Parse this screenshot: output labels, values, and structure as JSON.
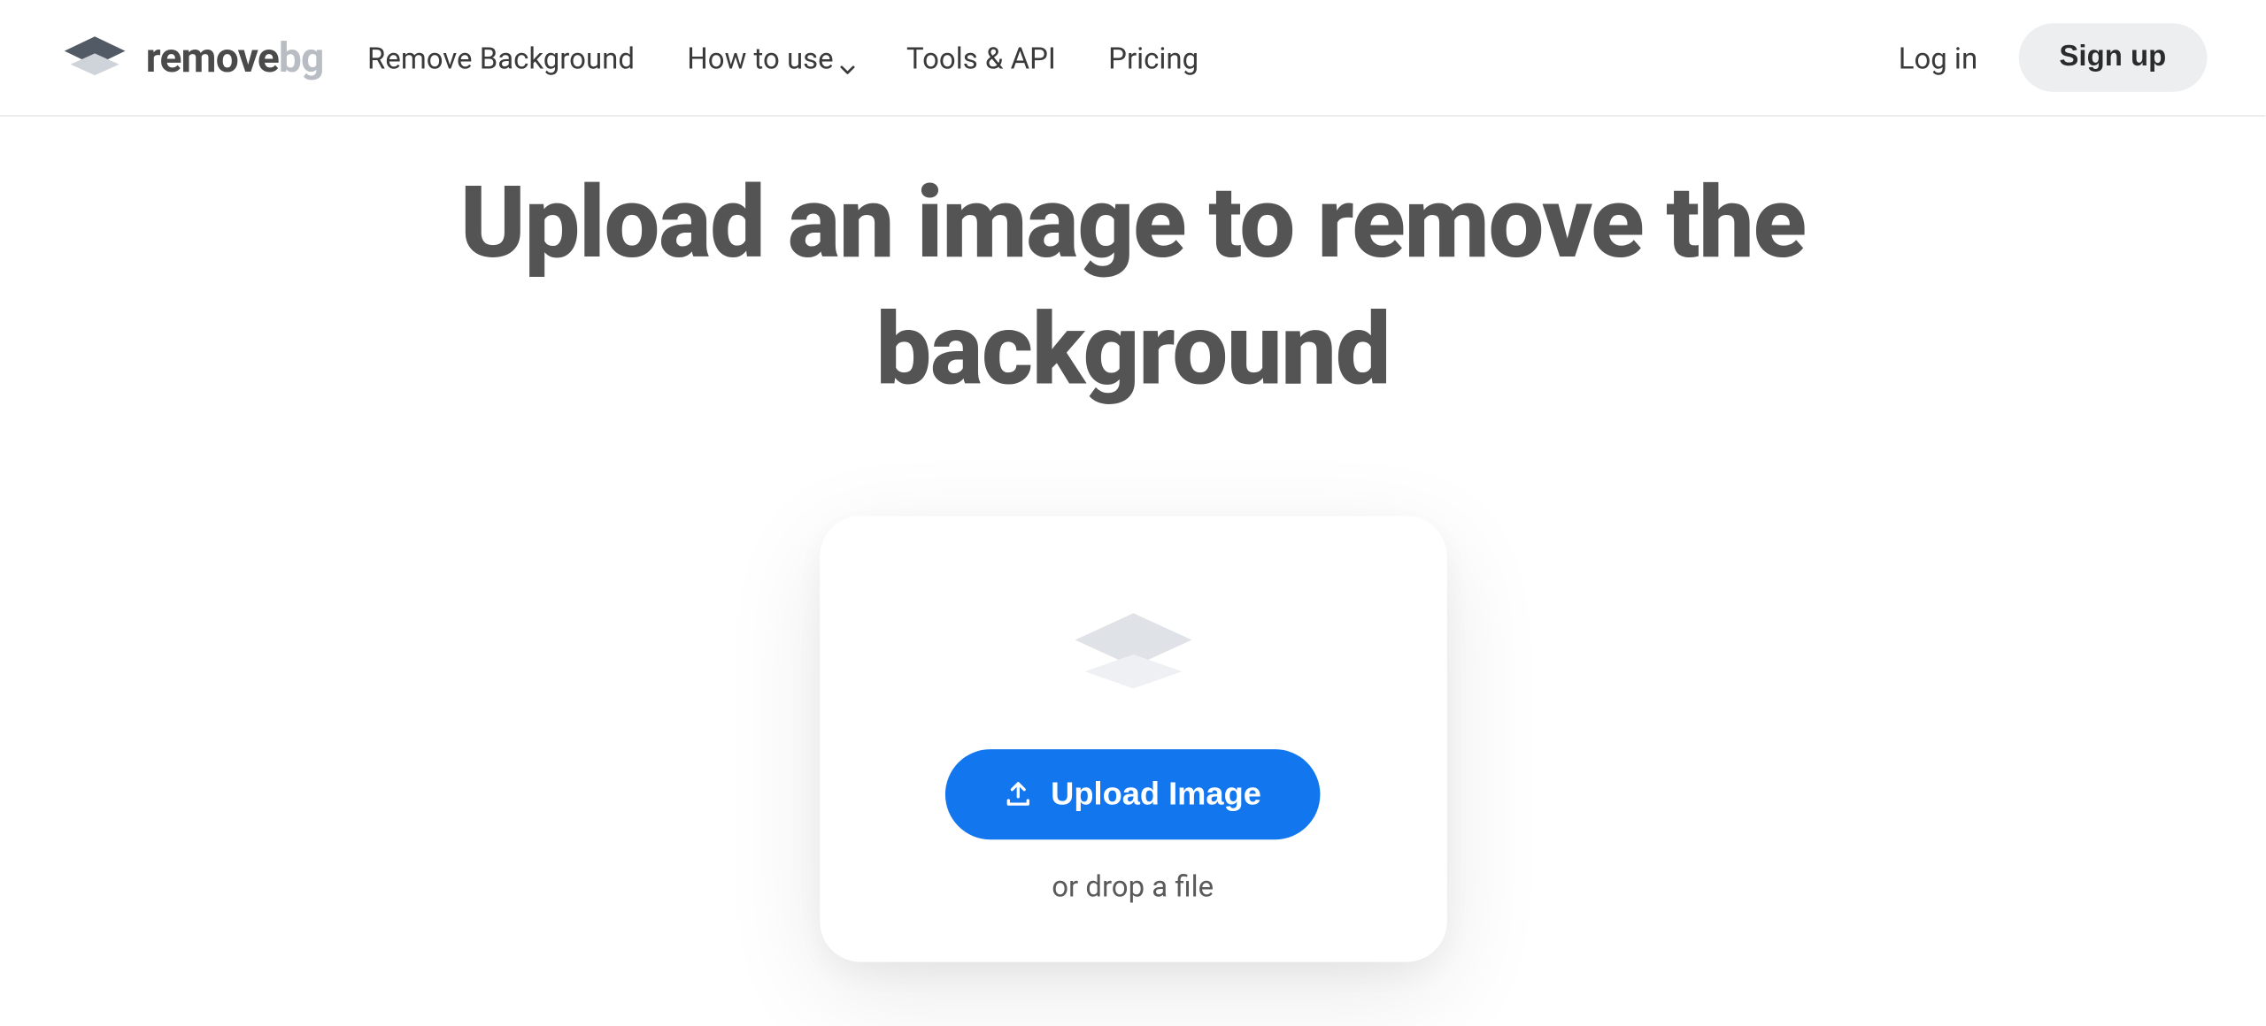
{
  "logo": {
    "text_remove": "remove",
    "text_bg": "bg"
  },
  "nav": {
    "items": [
      {
        "label": "Remove Background",
        "has_dropdown": false
      },
      {
        "label": "How to use",
        "has_dropdown": true
      },
      {
        "label": "Tools & API",
        "has_dropdown": false
      },
      {
        "label": "Pricing",
        "has_dropdown": false
      }
    ]
  },
  "auth": {
    "login_label": "Log in",
    "signup_label": "Sign up"
  },
  "hero": {
    "title": "Upload an image to remove the background"
  },
  "upload": {
    "button_label": "Upload Image",
    "drop_text": "or drop a file"
  }
}
